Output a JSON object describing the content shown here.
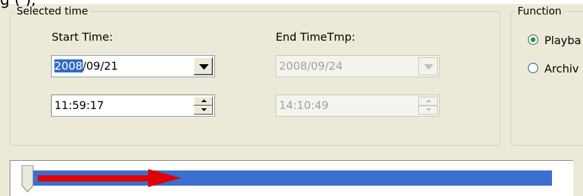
{
  "caption_fragment": "g (  ), ",
  "selected_time": {
    "legend": "Selected time",
    "start_label": "Start Time:",
    "end_label": "End TimeTmp:",
    "start_date": {
      "year": "2008",
      "rest": "/09/21"
    },
    "start_time": "11:59:17",
    "end_date": "2008/09/24",
    "end_time": "14:10:49"
  },
  "function": {
    "legend": "Function",
    "options": [
      {
        "label": "Playba",
        "checked": true
      },
      {
        "label": "Archiv",
        "checked": false
      }
    ]
  },
  "timeline": {
    "progress": 0.995,
    "arrow_color": "#e00000",
    "fill_color": "#3a6fd0"
  }
}
